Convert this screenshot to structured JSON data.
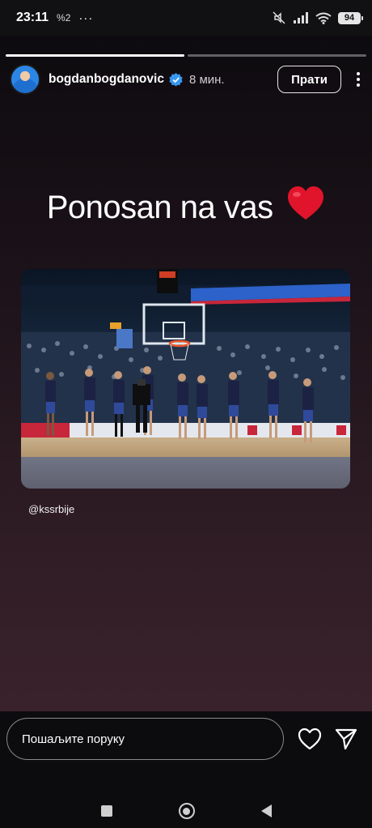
{
  "status_bar": {
    "time": "23:11",
    "extra": "%2",
    "dots": "···",
    "battery": "94",
    "icons": [
      "mute-icon",
      "signal-icon",
      "wifi-icon",
      "battery-icon"
    ]
  },
  "story": {
    "progress": [
      1,
      0
    ],
    "username": "bogdanbogdanovic",
    "verified": true,
    "time_ago": "8 мин.",
    "follow_label": "Прати",
    "caption": "Ponosan na vas",
    "mention": "@kssrbije",
    "photo_description": "Serbia national basketball team lined up on court during anthem"
  },
  "reply": {
    "placeholder": "Пошаљите поруку"
  },
  "colors": {
    "accent": "#ffffff",
    "verified_blue": "#3897f0",
    "heart_red": "#e0142b",
    "jersey": "#1c2244"
  }
}
